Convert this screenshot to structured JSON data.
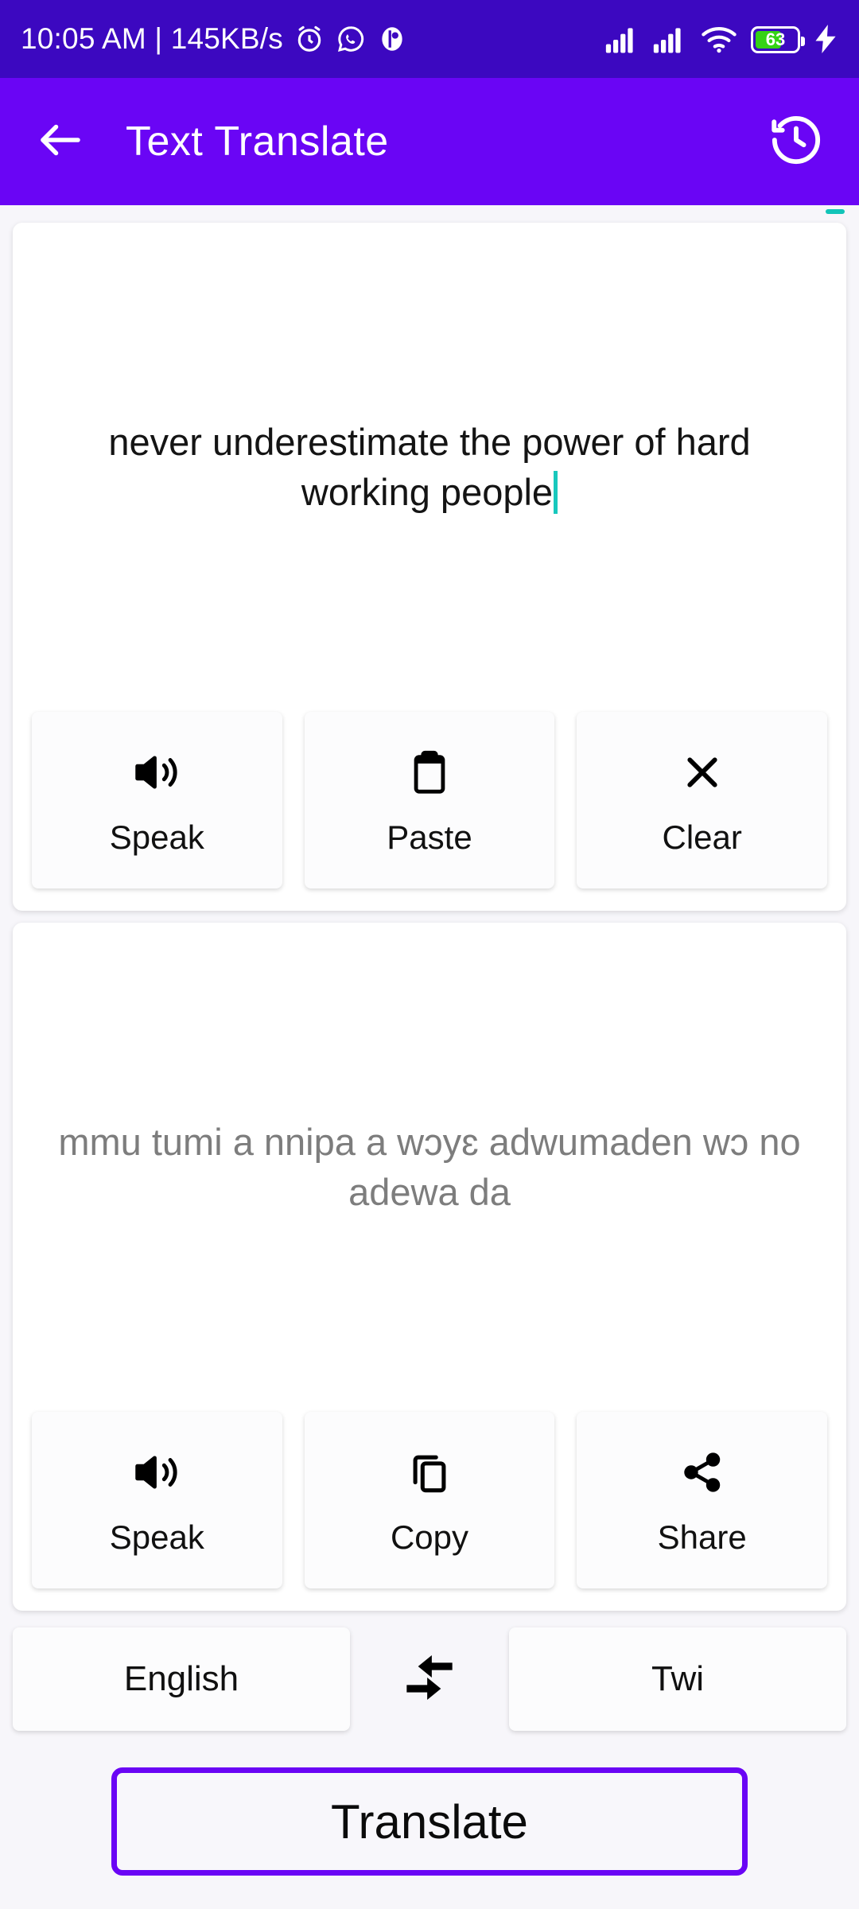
{
  "status_bar": {
    "clock": "10:05 AM | 145KB/s",
    "icons": [
      "alarm-icon",
      "whatsapp-icon",
      "app-notification-icon"
    ],
    "signal_1": "signal-bars-icon",
    "signal_2": "signal-bars-icon",
    "wifi": "wifi-icon",
    "battery_percent": "63",
    "charging": "charging-bolt-icon",
    "background_color": "#3c08c0"
  },
  "app_bar": {
    "back_label": "back-arrow",
    "title": "Text Translate",
    "history_label": "history",
    "background_color": "#6a05f5"
  },
  "source_panel": {
    "text": "never underestimate the power of hard working people",
    "has_caret": true,
    "caret_color": "#18c8bd",
    "actions": [
      {
        "label": "Speak",
        "icon": "volume-up-icon"
      },
      {
        "label": "Paste",
        "icon": "clipboard-icon"
      },
      {
        "label": "Clear",
        "icon": "close-x-icon"
      }
    ]
  },
  "target_panel": {
    "text": "mmu tumi a nnipa a wɔyɛ adwumaden wɔ no adewa da",
    "text_color": "#7d7d7d",
    "actions": [
      {
        "label": "Speak",
        "icon": "volume-up-icon"
      },
      {
        "label": "Copy",
        "icon": "copy-icon"
      },
      {
        "label": "Share",
        "icon": "share-nodes-icon"
      }
    ]
  },
  "language_row": {
    "source_language": "English",
    "swap_icon": "swap-horizontal-icon",
    "target_language": "Twi"
  },
  "translate_button": {
    "label": "Translate",
    "border_color": "#6a05f5"
  }
}
